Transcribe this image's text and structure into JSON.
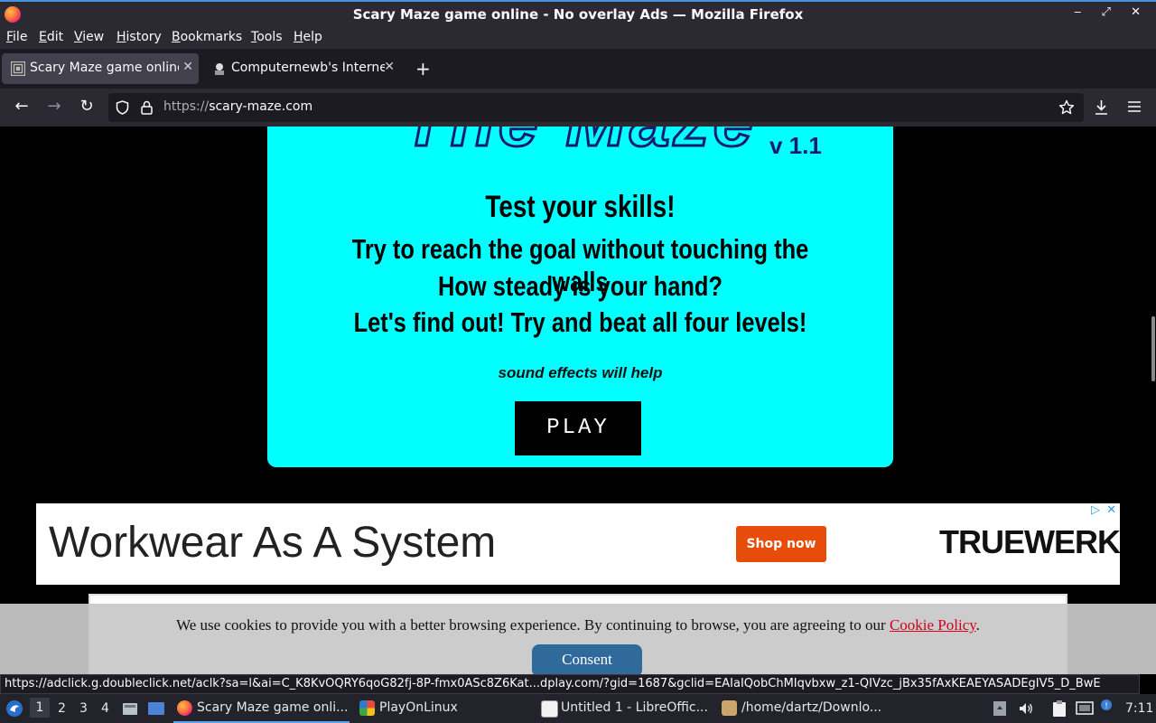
{
  "window": {
    "title": "Scary Maze game online - No overlay Ads — Mozilla Firefox",
    "controls": "‒ ⤢ ✕"
  },
  "menu": [
    "File",
    "Edit",
    "View",
    "History",
    "Bookmarks",
    "Tools",
    "Help"
  ],
  "tabs": [
    {
      "label": "Scary Maze game online - No overlay Ads",
      "active": true,
      "close": "✕"
    },
    {
      "label": "Computernewb's Internet",
      "active": false,
      "close": "✕"
    }
  ],
  "new_tab": "+",
  "nav": {
    "back": "←",
    "forward": "→",
    "reload": "↻",
    "url_scheme": "https://",
    "url_host": "scary-maze.com"
  },
  "game": {
    "title": "The Maze",
    "version": "v 1.1",
    "lines": [
      "Test your skills!",
      "Try to reach the goal without touching the walls",
      "How steady is your hand?",
      "Let's find out! Try and beat all four levels!"
    ],
    "sound_note": "sound effects will help",
    "play": "PLAY"
  },
  "ad": {
    "headline": "Workwear As A System",
    "cta": "Shop now",
    "brand": "TRUEWERK",
    "choices": "▷",
    "close": "✕"
  },
  "cookie": {
    "text": "We use cookies to provide you with a better browsing experience. By continuing to browse, you are agreeing to our",
    "link": "Cookie Policy",
    "suffix": ".",
    "consent": "Consent"
  },
  "status_url": "https://adclick.g.doubleclick.net/aclk?sa=l&ai=C_K8KvOQRY6qoG82fj-8P-fmx0ASc8Z6Kat...dplay.com/?gid=1687&gclid=EAIaIQobChMIqvbxw_z1-QIVzc_jBx35fAxKEAEYASADEgIV5_D_BwE",
  "taskbar": {
    "workspaces": [
      "1",
      "2",
      "3",
      "4"
    ],
    "tasks": [
      {
        "label": "Scary Maze game onli...",
        "active": true
      },
      {
        "label": "PlayOnLinux",
        "active": false
      },
      {
        "label": "Untitled 1 - LibreOffic...",
        "active": false
      },
      {
        "label": "/home/dartz/Downlo...",
        "active": false
      }
    ],
    "clock": "7:11"
  },
  "colors": {
    "game_bg": "#00ffff",
    "cta": "#e74c0a",
    "consent": "#2f6a9a",
    "link": "#d0021b"
  }
}
